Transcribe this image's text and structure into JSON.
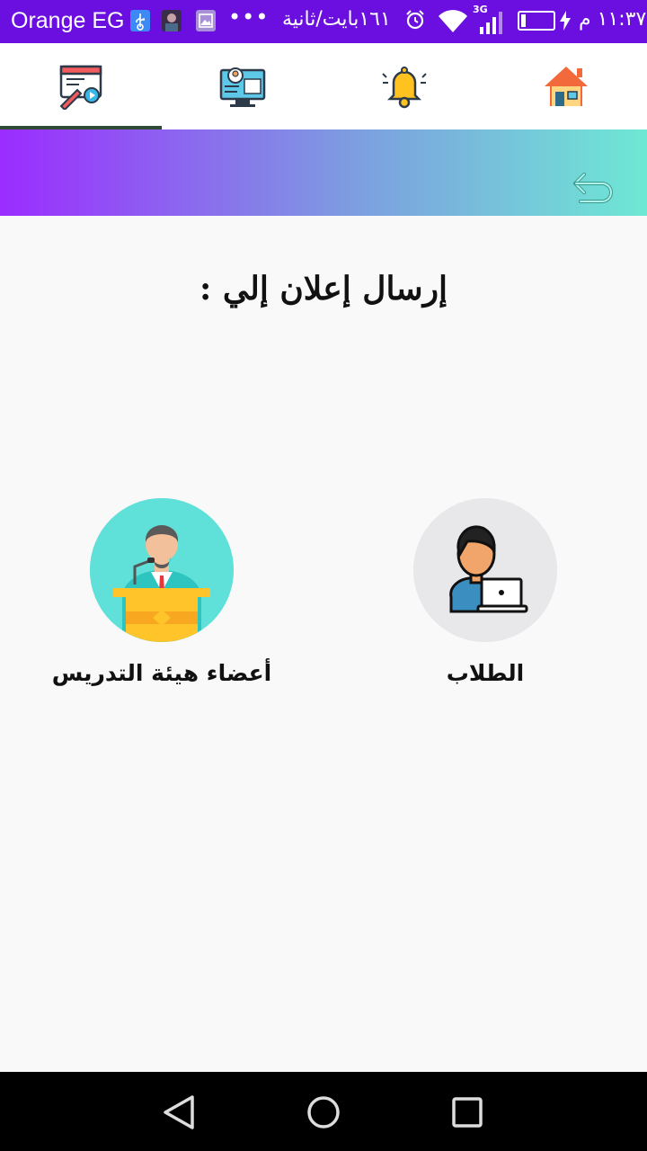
{
  "status_bar": {
    "carrier": "Orange EG",
    "overflow": "•••",
    "network_speed": "١٦١بايت/ثانية",
    "network_type": "3G",
    "battery": "١٤",
    "battery_level": 0.14,
    "time": "١١:٣٧ م"
  },
  "tabs": [
    {
      "icon": "announcement-edit-icon",
      "selected": true
    },
    {
      "icon": "computer-user-icon",
      "selected": false
    },
    {
      "icon": "bell-icon",
      "selected": false
    },
    {
      "icon": "home-icon",
      "selected": false
    }
  ],
  "header": {
    "back_icon": "back-arrow-icon",
    "gradient": [
      "#9b2cff",
      "#7d9ee0",
      "#6ee8d4"
    ]
  },
  "main": {
    "title": "إرسال إعلان إلي :",
    "options": {
      "staff": {
        "label": "أعضاء هيئة التدريس",
        "icon": "lecturer-podium-icon",
        "circle_color": "#5fe0d8"
      },
      "students": {
        "label": "الطلاب",
        "icon": "student-laptop-icon",
        "circle_color": "#e8e8ea"
      }
    }
  },
  "nav_bar": {
    "back_icon": "nav-back-icon",
    "home_icon": "nav-home-icon",
    "recents_icon": "nav-recents-icon"
  },
  "colors": {
    "status_bar": "#6a0fe0",
    "tab_indicator": "#2f4a35",
    "background": "#f9f9f9"
  }
}
